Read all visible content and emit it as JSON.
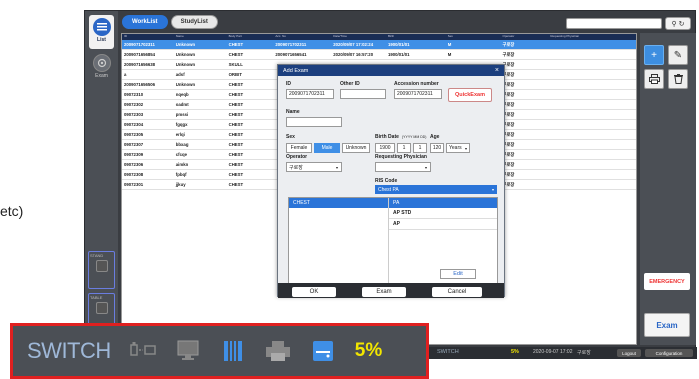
{
  "stray_text": "etc)",
  "nav": {
    "list_label": "List",
    "exam_label": "Exam",
    "stand_label": "STAND",
    "table_label": "TABLE"
  },
  "tabs": [
    {
      "label": "WorkList",
      "active": true
    },
    {
      "label": "StudyList",
      "active": false
    }
  ],
  "worklist": {
    "columns": [
      "ID",
      "Name",
      "Body Part",
      "Acc. No",
      "Date/Time",
      "Birth",
      "Sex",
      "Operator",
      "Requesting Physician"
    ],
    "rows": [
      {
        "id": "2009071702311",
        "name": "Unknown",
        "body": "CHEST",
        "acc": "2009071702311",
        "dt": "2020/09/07 17:02:24",
        "birth": "1900/01/01",
        "sex": "M",
        "op": "구로장",
        "selected": true
      },
      {
        "id": "2009071656854",
        "name": "Unknown",
        "body": "CHEST",
        "acc": "2009071656541",
        "dt": "2020/09/07 16:57:20",
        "birth": "1900/01/01",
        "sex": "M",
        "op": "구로장",
        "selected": false
      },
      {
        "id": "2009071656638",
        "name": "Unknown",
        "body": "SKULL",
        "acc": "",
        "dt": "",
        "birth": "",
        "sex": "",
        "op": "구로장",
        "selected": false
      },
      {
        "id": "a",
        "name": "adsf",
        "body": "ORBIT",
        "acc": "",
        "dt": "",
        "birth": "",
        "sex": "",
        "op": "구로장",
        "selected": false
      },
      {
        "id": "2009071656506",
        "name": "Unknown",
        "body": "CHEST",
        "acc": "",
        "dt": "",
        "birth": "",
        "sex": "",
        "op": "구로장",
        "selected": false
      },
      {
        "id": "09072310",
        "name": "nqeqb",
        "body": "CHEST",
        "acc": "",
        "dt": "",
        "birth": "",
        "sex": "",
        "op": "구로장",
        "selected": false
      },
      {
        "id": "09072302",
        "name": "oadmt",
        "body": "CHEST",
        "acc": "",
        "dt": "",
        "birth": "",
        "sex": "",
        "op": "구로장",
        "selected": false
      },
      {
        "id": "09072303",
        "name": "pmssi",
        "body": "CHEST",
        "acc": "",
        "dt": "",
        "birth": "",
        "sex": "",
        "op": "구로장",
        "selected": false
      },
      {
        "id": "09072304",
        "name": "fgqgx",
        "body": "CHEST",
        "acc": "",
        "dt": "",
        "birth": "",
        "sex": "",
        "op": "구로장",
        "selected": false
      },
      {
        "id": "09072305",
        "name": "erlqi",
        "body": "CHEST",
        "acc": "",
        "dt": "",
        "birth": "",
        "sex": "",
        "op": "구로장",
        "selected": false
      },
      {
        "id": "09072307",
        "name": "bbxag",
        "body": "CHEST",
        "acc": "",
        "dt": "",
        "birth": "",
        "sex": "",
        "op": "구로장",
        "selected": false
      },
      {
        "id": "09072309",
        "name": "cfcqe",
        "body": "CHEST",
        "acc": "",
        "dt": "",
        "birth": "",
        "sex": "",
        "op": "구로장",
        "selected": false
      },
      {
        "id": "09072306",
        "name": "aimkn",
        "body": "CHEST",
        "acc": "",
        "dt": "",
        "birth": "",
        "sex": "",
        "op": "구로장",
        "selected": false
      },
      {
        "id": "09072308",
        "name": "fpbqf",
        "body": "CHEST",
        "acc": "",
        "dt": "",
        "birth": "",
        "sex": "",
        "op": "구로장",
        "selected": false
      },
      {
        "id": "09072301",
        "name": "jjkuy",
        "body": "CHEST",
        "acc": "",
        "dt": "",
        "birth": "",
        "sex": "",
        "op": "구로장",
        "selected": false
      }
    ]
  },
  "right_panel": {
    "add_icon": "+",
    "edit_icon": "✎",
    "print_icon": "print-icon",
    "delete_icon": "trash-icon",
    "emergency_label": "EMERGENCY",
    "exam_label": "Exam"
  },
  "dialog": {
    "title": "Add Exam",
    "close": "×",
    "id_label": "ID",
    "id_value": "2009071702311",
    "other_id_label": "Other ID",
    "other_id_value": "",
    "accession_label": "Accession number",
    "accession_value": "2009071702311",
    "quickexam_label": "QuickExam",
    "name_label": "Name",
    "name_value": "",
    "sex_label": "Sex",
    "sex_options": [
      "Female",
      "Male",
      "Unknown"
    ],
    "sex_selected": "Male",
    "birth_label": "Birth Date",
    "birth_format": "(YYYY MM DD)",
    "birth_year": "1900",
    "birth_month": "1",
    "birth_day": "1",
    "age_label": "Age",
    "age_value": "120",
    "age_unit": "Years",
    "operator_label": "Operator",
    "operator_value": "구로장",
    "physician_label": "Requesting Physician",
    "physician_value": "",
    "ris_label": "RIS Code",
    "ris_selected": "Chest PA",
    "ris_left_header": "CHEST",
    "ris_right_header": "PA",
    "ris_items": [
      "AP STD",
      "AP"
    ],
    "edit_label": "Edit",
    "ok_label": "OK",
    "exam_label": "Exam",
    "cancel_label": "Cancel"
  },
  "status": {
    "switch_label": "SWITCH",
    "percent": "5%",
    "datetime": "2020-09-07 17:02",
    "user": "구로장",
    "logout_label": "Logout",
    "config_label": "Configuration"
  },
  "zoom": {
    "switch_label": "SWITCH",
    "icons": [
      "detector-link-icon",
      "monitor-icon",
      "battery-icon",
      "printer-icon",
      "storage-icon"
    ],
    "percent": "5%",
    "highlight_color": "#e02020",
    "percent_color": "#f2e600"
  }
}
